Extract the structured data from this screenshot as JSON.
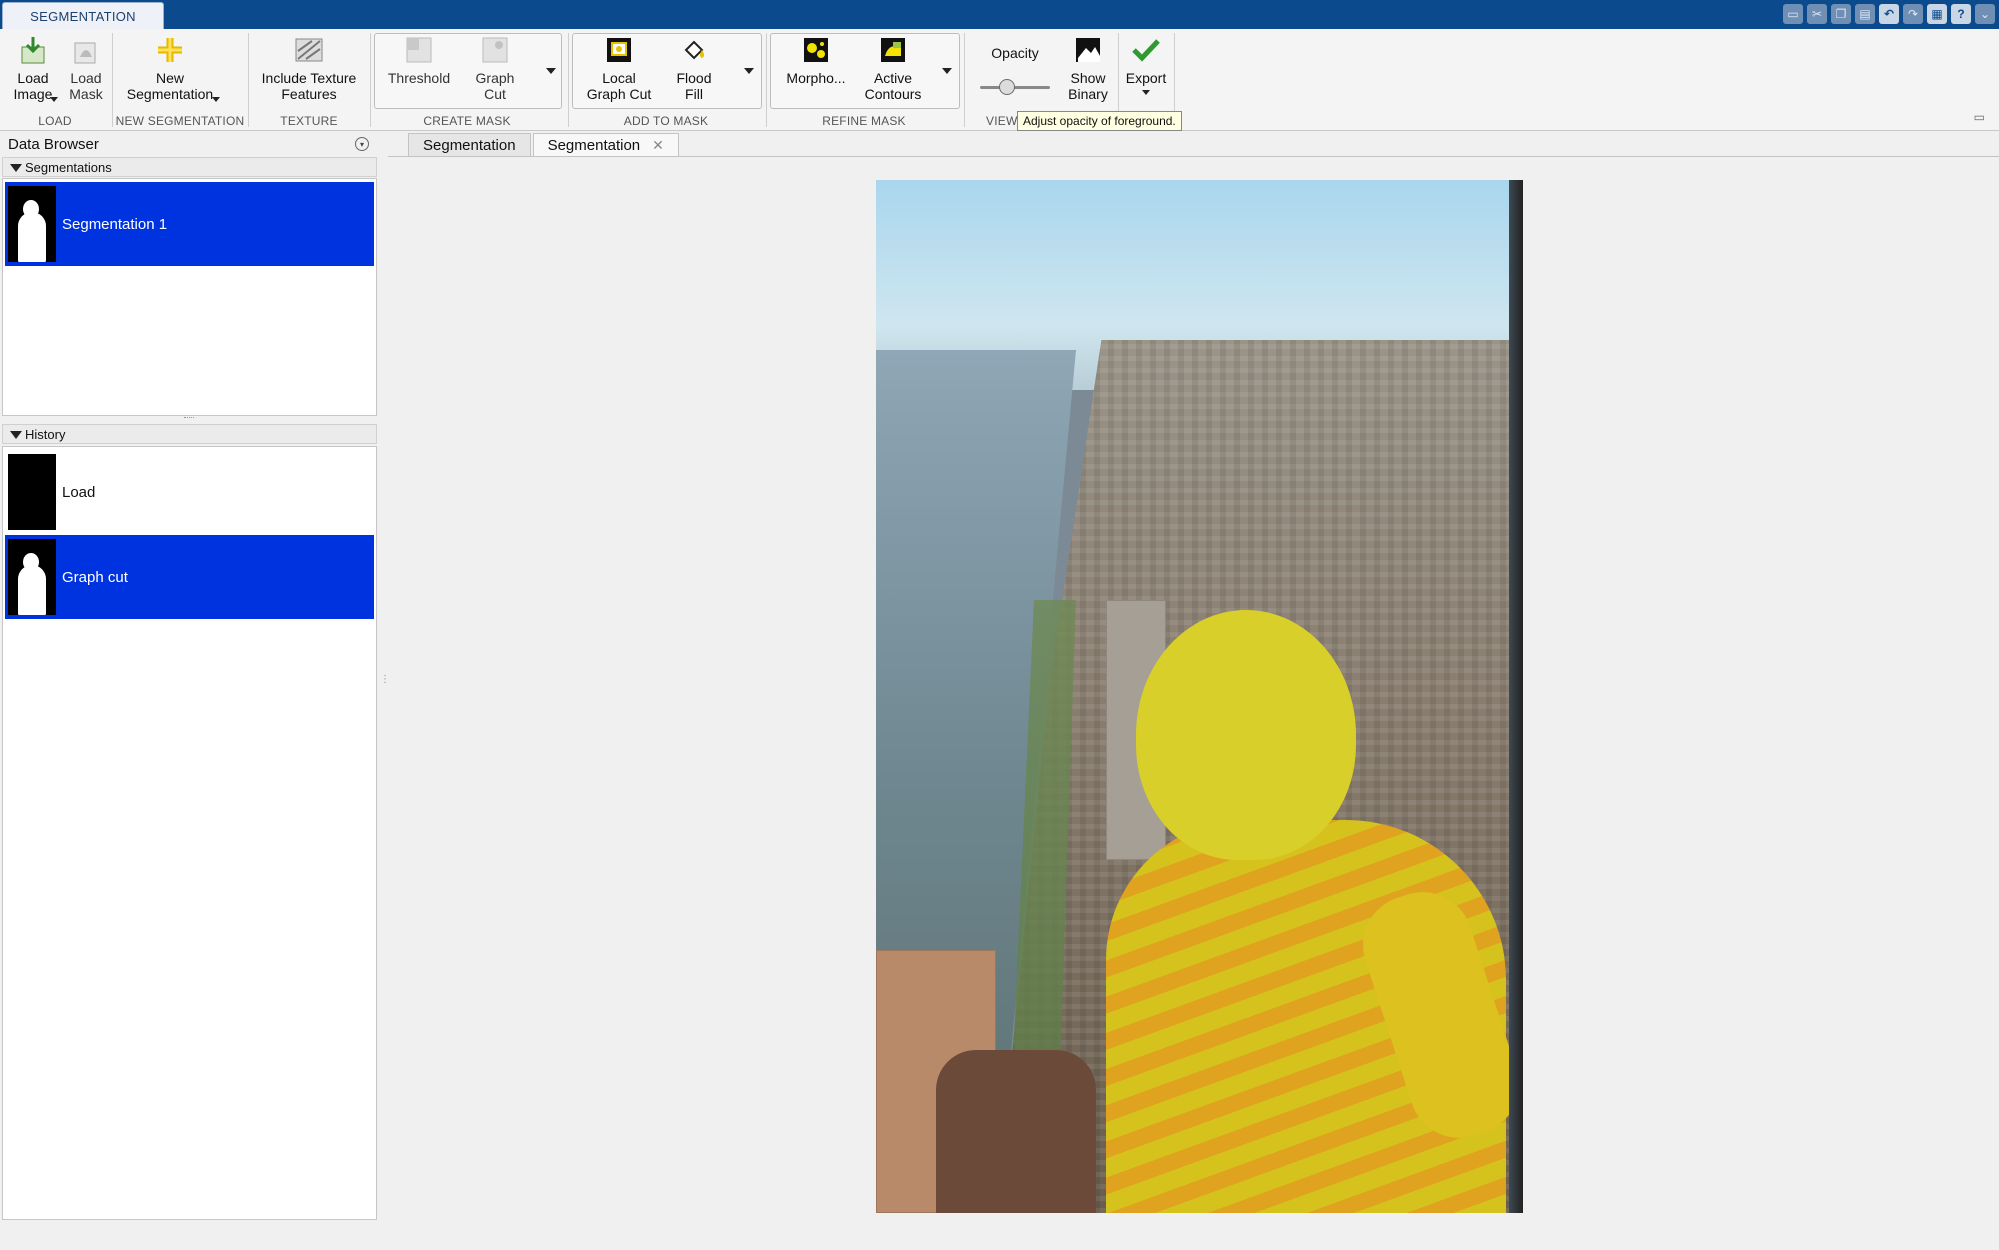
{
  "app": {
    "tab_label": "SEGMENTATION"
  },
  "quick_access": [
    "save-icon",
    "cut-icon",
    "copy-icon",
    "paste-icon",
    "undo-icon",
    "redo-icon",
    "switch-windows-icon",
    "help-icon",
    "options-icon"
  ],
  "ribbon": {
    "load": {
      "group": "LOAD",
      "load_image": "Load\nImage",
      "load_mask": "Load\nMask"
    },
    "new_segmentation": {
      "group": "NEW SEGMENTATION",
      "button": "New\nSegmentation"
    },
    "texture": {
      "group": "TEXTURE",
      "button": "Include Texture\nFeatures"
    },
    "create_mask": {
      "group": "CREATE MASK",
      "threshold": "Threshold",
      "graph_cut": "Graph\nCut"
    },
    "add_to_mask": {
      "group": "ADD TO MASK",
      "local_graph_cut": "Local\nGraph Cut",
      "flood_fill": "Flood\nFill"
    },
    "refine_mask": {
      "group": "REFINE MASK",
      "morphology": "Morpho...",
      "active_contours": "Active\nContours"
    },
    "view": {
      "group": "VIEW",
      "opacity_label": "Opacity",
      "opacity_value": 0.35,
      "show_binary": "Show\nBinary"
    },
    "export": {
      "button": "Export"
    },
    "tooltip": "Adjust opacity of foreground."
  },
  "data_browser": {
    "title": "Data Browser",
    "segmentations_header": "Segmentations",
    "segmentations": [
      {
        "label": "Segmentation 1",
        "selected": true
      }
    ],
    "history_header": "History",
    "history": [
      {
        "label": "Load",
        "selected": false
      },
      {
        "label": "Graph cut",
        "selected": true
      }
    ]
  },
  "document_tabs": [
    {
      "label": "Segmentation",
      "active": false
    },
    {
      "label": "Segmentation",
      "active": true,
      "closable": true
    }
  ],
  "colors": {
    "title_bar": "#0b4a8c",
    "selection": "#0033e0",
    "foreground_overlay": "#d8cf2a"
  }
}
